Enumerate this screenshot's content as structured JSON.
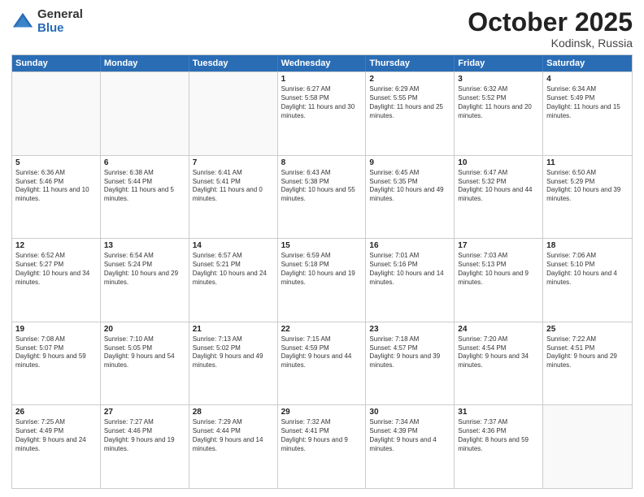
{
  "logo": {
    "general": "General",
    "blue": "Blue"
  },
  "header": {
    "month": "October 2025",
    "location": "Kodinsk, Russia"
  },
  "weekdays": [
    "Sunday",
    "Monday",
    "Tuesday",
    "Wednesday",
    "Thursday",
    "Friday",
    "Saturday"
  ],
  "rows": [
    [
      {
        "day": "",
        "sunrise": "",
        "sunset": "",
        "daylight": ""
      },
      {
        "day": "",
        "sunrise": "",
        "sunset": "",
        "daylight": ""
      },
      {
        "day": "",
        "sunrise": "",
        "sunset": "",
        "daylight": ""
      },
      {
        "day": "1",
        "sunrise": "Sunrise: 6:27 AM",
        "sunset": "Sunset: 5:58 PM",
        "daylight": "Daylight: 11 hours and 30 minutes."
      },
      {
        "day": "2",
        "sunrise": "Sunrise: 6:29 AM",
        "sunset": "Sunset: 5:55 PM",
        "daylight": "Daylight: 11 hours and 25 minutes."
      },
      {
        "day": "3",
        "sunrise": "Sunrise: 6:32 AM",
        "sunset": "Sunset: 5:52 PM",
        "daylight": "Daylight: 11 hours and 20 minutes."
      },
      {
        "day": "4",
        "sunrise": "Sunrise: 6:34 AM",
        "sunset": "Sunset: 5:49 PM",
        "daylight": "Daylight: 11 hours and 15 minutes."
      }
    ],
    [
      {
        "day": "5",
        "sunrise": "Sunrise: 6:36 AM",
        "sunset": "Sunset: 5:46 PM",
        "daylight": "Daylight: 11 hours and 10 minutes."
      },
      {
        "day": "6",
        "sunrise": "Sunrise: 6:38 AM",
        "sunset": "Sunset: 5:44 PM",
        "daylight": "Daylight: 11 hours and 5 minutes."
      },
      {
        "day": "7",
        "sunrise": "Sunrise: 6:41 AM",
        "sunset": "Sunset: 5:41 PM",
        "daylight": "Daylight: 11 hours and 0 minutes."
      },
      {
        "day": "8",
        "sunrise": "Sunrise: 6:43 AM",
        "sunset": "Sunset: 5:38 PM",
        "daylight": "Daylight: 10 hours and 55 minutes."
      },
      {
        "day": "9",
        "sunrise": "Sunrise: 6:45 AM",
        "sunset": "Sunset: 5:35 PM",
        "daylight": "Daylight: 10 hours and 49 minutes."
      },
      {
        "day": "10",
        "sunrise": "Sunrise: 6:47 AM",
        "sunset": "Sunset: 5:32 PM",
        "daylight": "Daylight: 10 hours and 44 minutes."
      },
      {
        "day": "11",
        "sunrise": "Sunrise: 6:50 AM",
        "sunset": "Sunset: 5:29 PM",
        "daylight": "Daylight: 10 hours and 39 minutes."
      }
    ],
    [
      {
        "day": "12",
        "sunrise": "Sunrise: 6:52 AM",
        "sunset": "Sunset: 5:27 PM",
        "daylight": "Daylight: 10 hours and 34 minutes."
      },
      {
        "day": "13",
        "sunrise": "Sunrise: 6:54 AM",
        "sunset": "Sunset: 5:24 PM",
        "daylight": "Daylight: 10 hours and 29 minutes."
      },
      {
        "day": "14",
        "sunrise": "Sunrise: 6:57 AM",
        "sunset": "Sunset: 5:21 PM",
        "daylight": "Daylight: 10 hours and 24 minutes."
      },
      {
        "day": "15",
        "sunrise": "Sunrise: 6:59 AM",
        "sunset": "Sunset: 5:18 PM",
        "daylight": "Daylight: 10 hours and 19 minutes."
      },
      {
        "day": "16",
        "sunrise": "Sunrise: 7:01 AM",
        "sunset": "Sunset: 5:16 PM",
        "daylight": "Daylight: 10 hours and 14 minutes."
      },
      {
        "day": "17",
        "sunrise": "Sunrise: 7:03 AM",
        "sunset": "Sunset: 5:13 PM",
        "daylight": "Daylight: 10 hours and 9 minutes."
      },
      {
        "day": "18",
        "sunrise": "Sunrise: 7:06 AM",
        "sunset": "Sunset: 5:10 PM",
        "daylight": "Daylight: 10 hours and 4 minutes."
      }
    ],
    [
      {
        "day": "19",
        "sunrise": "Sunrise: 7:08 AM",
        "sunset": "Sunset: 5:07 PM",
        "daylight": "Daylight: 9 hours and 59 minutes."
      },
      {
        "day": "20",
        "sunrise": "Sunrise: 7:10 AM",
        "sunset": "Sunset: 5:05 PM",
        "daylight": "Daylight: 9 hours and 54 minutes."
      },
      {
        "day": "21",
        "sunrise": "Sunrise: 7:13 AM",
        "sunset": "Sunset: 5:02 PM",
        "daylight": "Daylight: 9 hours and 49 minutes."
      },
      {
        "day": "22",
        "sunrise": "Sunrise: 7:15 AM",
        "sunset": "Sunset: 4:59 PM",
        "daylight": "Daylight: 9 hours and 44 minutes."
      },
      {
        "day": "23",
        "sunrise": "Sunrise: 7:18 AM",
        "sunset": "Sunset: 4:57 PM",
        "daylight": "Daylight: 9 hours and 39 minutes."
      },
      {
        "day": "24",
        "sunrise": "Sunrise: 7:20 AM",
        "sunset": "Sunset: 4:54 PM",
        "daylight": "Daylight: 9 hours and 34 minutes."
      },
      {
        "day": "25",
        "sunrise": "Sunrise: 7:22 AM",
        "sunset": "Sunset: 4:51 PM",
        "daylight": "Daylight: 9 hours and 29 minutes."
      }
    ],
    [
      {
        "day": "26",
        "sunrise": "Sunrise: 7:25 AM",
        "sunset": "Sunset: 4:49 PM",
        "daylight": "Daylight: 9 hours and 24 minutes."
      },
      {
        "day": "27",
        "sunrise": "Sunrise: 7:27 AM",
        "sunset": "Sunset: 4:46 PM",
        "daylight": "Daylight: 9 hours and 19 minutes."
      },
      {
        "day": "28",
        "sunrise": "Sunrise: 7:29 AM",
        "sunset": "Sunset: 4:44 PM",
        "daylight": "Daylight: 9 hours and 14 minutes."
      },
      {
        "day": "29",
        "sunrise": "Sunrise: 7:32 AM",
        "sunset": "Sunset: 4:41 PM",
        "daylight": "Daylight: 9 hours and 9 minutes."
      },
      {
        "day": "30",
        "sunrise": "Sunrise: 7:34 AM",
        "sunset": "Sunset: 4:39 PM",
        "daylight": "Daylight: 9 hours and 4 minutes."
      },
      {
        "day": "31",
        "sunrise": "Sunrise: 7:37 AM",
        "sunset": "Sunset: 4:36 PM",
        "daylight": "Daylight: 8 hours and 59 minutes."
      },
      {
        "day": "",
        "sunrise": "",
        "sunset": "",
        "daylight": ""
      }
    ]
  ]
}
